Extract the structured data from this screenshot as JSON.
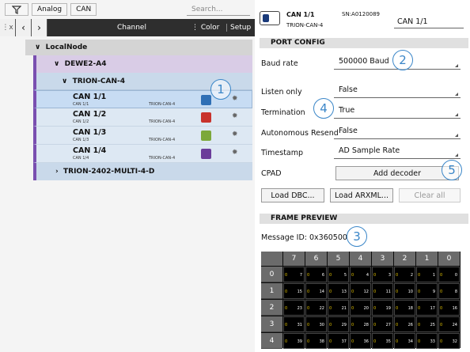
{
  "toolbar": {
    "analog": "Analog",
    "can": "CAN",
    "search_placeholder": "Search..."
  },
  "columns": {
    "x_label": "x",
    "channel": "Channel",
    "color": "Color",
    "setup": "Setup"
  },
  "tree": {
    "localnode": "LocalNode",
    "dewe": "DEWE2-A4",
    "trion_can": "TRION-CAN-4",
    "trion_2402": "TRION-2402-MULTI-4-D",
    "channels": [
      {
        "name": "CAN 1/1",
        "sub": "CAN 1/1",
        "dev": "TRION-CAN-4",
        "color": "#2f6fb5"
      },
      {
        "name": "CAN 1/2",
        "sub": "CAN 1/2",
        "dev": "TRION-CAN-4",
        "color": "#c8322c"
      },
      {
        "name": "CAN 1/3",
        "sub": "CAN 1/3",
        "dev": "TRION-CAN-4",
        "color": "#7ca83a"
      },
      {
        "name": "CAN 1/4",
        "sub": "CAN 1/4",
        "dev": "TRION-CAN-4",
        "color": "#6b3d9a"
      }
    ]
  },
  "header": {
    "name": "CAN 1/1",
    "device": "TRION-CAN-4",
    "sn": "SN:A0120089",
    "name_field": "CAN 1/1"
  },
  "port_config": {
    "title": "PORT CONFIG",
    "baud_label": "Baud rate",
    "baud": "500000 Baud",
    "listen_label": "Listen only",
    "listen": "False",
    "term_label": "Termination",
    "term": "True",
    "auto_label": "Autonomous Resend",
    "auto": "False",
    "ts_label": "Timestamp",
    "ts": "AD Sample Rate",
    "cpad_label": "CPAD",
    "add_decoder": "Add decoder",
    "load_dbc": "Load DBC...",
    "load_arxml": "Load ARXML...",
    "clear_all": "Clear all"
  },
  "frame_preview": {
    "title": "FRAME PREVIEW",
    "message_id": "Message ID: 0x360500",
    "cols": [
      "7",
      "6",
      "5",
      "4",
      "3",
      "2",
      "1",
      "0"
    ],
    "rows": [
      "0",
      "1",
      "2",
      "3",
      "4"
    ],
    "cells": [
      [
        7,
        6,
        5,
        4,
        3,
        2,
        1,
        0
      ],
      [
        15,
        14,
        13,
        12,
        11,
        10,
        9,
        8
      ],
      [
        23,
        22,
        21,
        20,
        19,
        18,
        17,
        16
      ],
      [
        31,
        30,
        29,
        28,
        27,
        26,
        25,
        24
      ],
      [
        39,
        38,
        37,
        36,
        35,
        34,
        33,
        32
      ]
    ]
  },
  "markers": {
    "m1": "1",
    "m2": "2",
    "m3": "3",
    "m4": "4",
    "m5": "5"
  }
}
